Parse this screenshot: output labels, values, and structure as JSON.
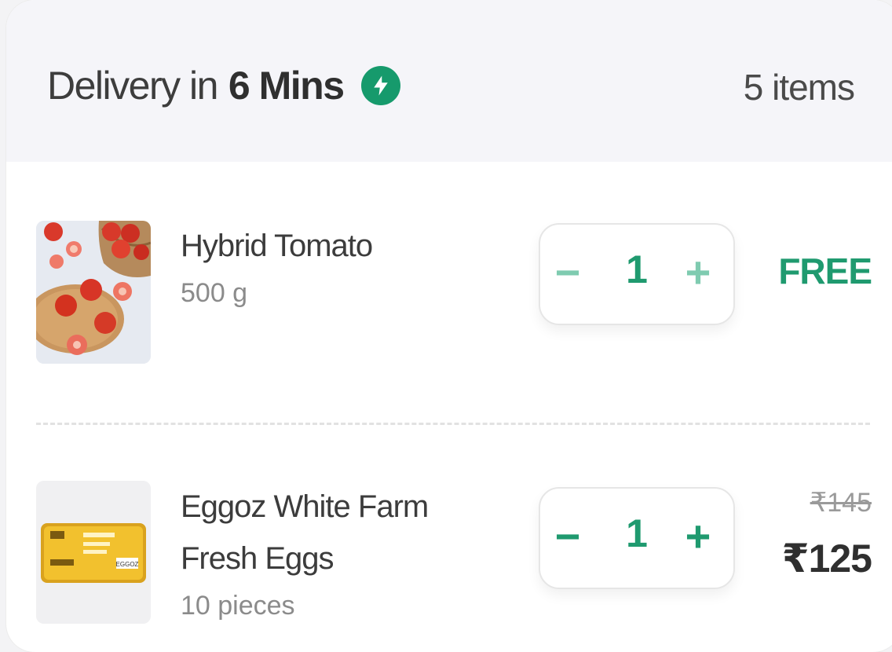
{
  "header": {
    "prefix": "Delivery in",
    "time": "6 Mins",
    "icon": "bolt-icon",
    "item_count": "5 items"
  },
  "items": [
    {
      "name": "Hybrid Tomato",
      "quantity_label": "500 g",
      "count": "1",
      "price": "FREE",
      "image": "tomato-image"
    },
    {
      "name_line1": "Eggoz White Farm",
      "name_line2": "Fresh Eggs",
      "quantity_label": "10 pieces",
      "count": "1",
      "mrp": "₹145",
      "price": "₹125",
      "image": "eggs-image",
      "pack_text": "EGGOZ"
    }
  ],
  "stepper": {
    "minus": "−",
    "plus": "+"
  },
  "colors": {
    "accent": "#1f9a6f",
    "header_bg": "#f5f5f9"
  }
}
